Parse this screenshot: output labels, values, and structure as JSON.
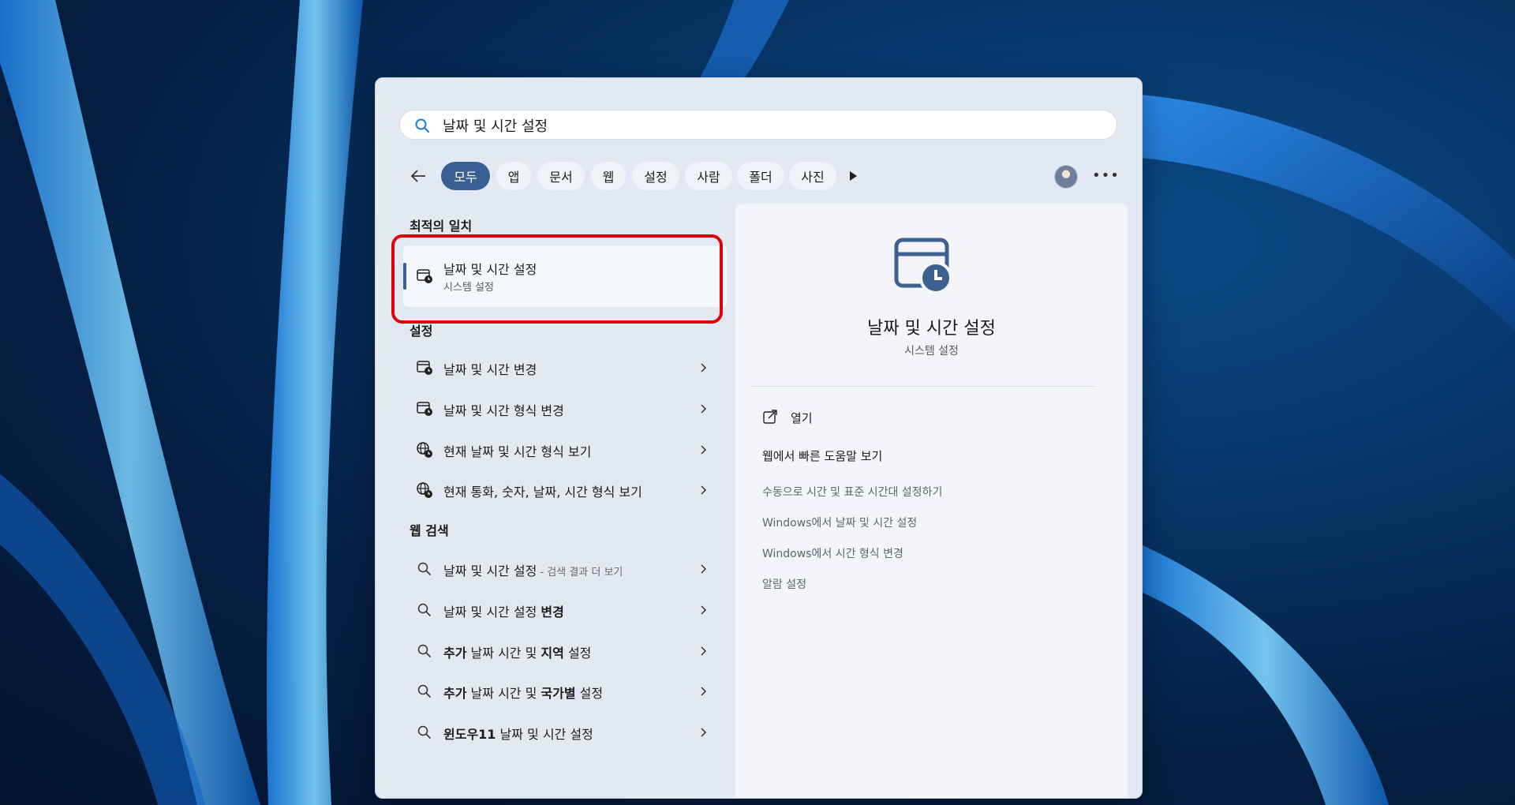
{
  "search": {
    "value": "날짜 및 시간 설정"
  },
  "filters": {
    "items": [
      "모두",
      "앱",
      "문서",
      "웹",
      "설정",
      "사람",
      "폴더",
      "사진"
    ],
    "active": "모두"
  },
  "icons": {
    "search": "search-icon",
    "back": "back-arrow-icon",
    "play": "play-icon",
    "more": "more-icon",
    "settings": "calendar-clock-icon",
    "globe": "globe-clock-icon",
    "open": "open-external-icon",
    "chevron": "chevron-right-icon"
  },
  "colors": {
    "accent": "#3a5f92",
    "highlight": "#e0000a"
  },
  "left": {
    "best_match_heading": "최적의 일치",
    "best_match": {
      "title": "날짜 및 시간 설정",
      "subtitle": "시스템 설정"
    },
    "settings_heading": "설정",
    "settings_items": [
      "날짜 및 시간 변경",
      "날짜 및 시간 형식 변경",
      "현재 날짜 및 시간 형식 보기",
      "현재 통화, 숫자, 날짜, 시간 형식 보기"
    ],
    "web_heading": "웹 검색",
    "web_items": [
      {
        "pre": "",
        "text": "날짜 및 시간 설정",
        "post": "",
        "sub": " - 검색 결과 더 보기"
      },
      {
        "pre": "",
        "text": "날짜 및 시간 설정 ",
        "post": "변경",
        "sub": ""
      },
      {
        "pre": "추가",
        "text": " 날짜 시간 및 ",
        "post": "지역",
        "tail": " 설정"
      },
      {
        "pre": "추가",
        "text": " 날짜 시간 및 ",
        "post": "국가별",
        "tail": " 설정"
      },
      {
        "pre": "윈도우11",
        "text": " 날짜 및 시간 설정",
        "post": "",
        "tail": ""
      }
    ]
  },
  "right": {
    "title": "날짜 및 시간 설정",
    "subtitle": "시스템 설정",
    "open_label": "열기",
    "help_heading": "웹에서 빠른 도움말 보기",
    "links": [
      "수동으로 시간 및 표준 시간대 설정하기",
      "Windows에서 날짜 및 시간 설정",
      "Windows에서 시간 형식 변경",
      "알람 설정"
    ]
  }
}
